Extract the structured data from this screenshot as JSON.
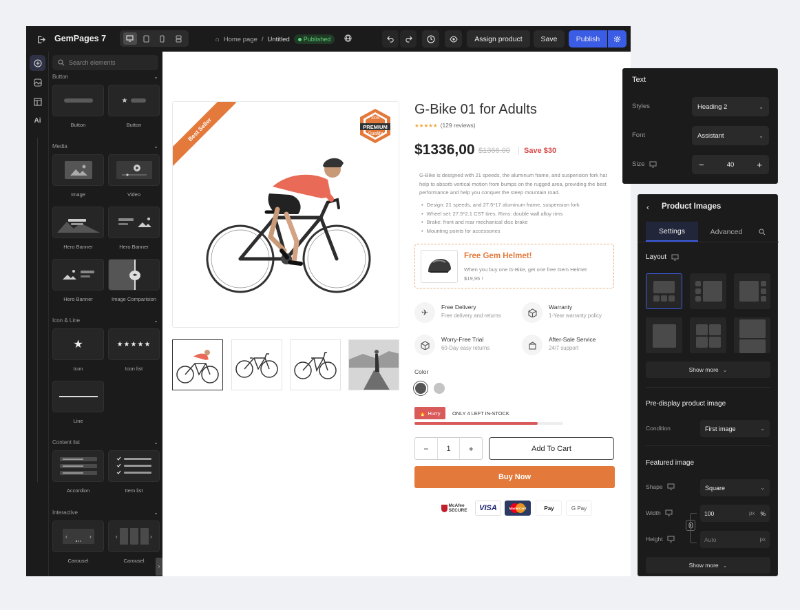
{
  "topbar": {
    "app_name": "GemPages 7",
    "breadcrumb_home": "Home page",
    "breadcrumb_sep": "/",
    "page_name": "Untitled",
    "status": "Published",
    "assign_product": "Assign product",
    "save": "Save",
    "publish": "Publish"
  },
  "elements_panel": {
    "search_placeholder": "Search elements",
    "sections": {
      "button": "Button",
      "media": "Media",
      "icon_line": "Icon & Line",
      "content_list": "Content list",
      "interactive": "Interactive"
    },
    "items": {
      "button1": "Button",
      "button2": "Button",
      "image": "Image",
      "video": "Video",
      "hero1": "Hero Banner",
      "hero2": "Hero Banner",
      "hero3": "Hero Banner",
      "image_comparison": "Image Comparision",
      "icon": "Icon",
      "icon_list": "Icon list",
      "line": "Line",
      "accordion": "Accordion",
      "item_list": "Item list",
      "carousel1": "Carousel",
      "carousel2": "Carousel"
    }
  },
  "product": {
    "ribbon": "Best Seller",
    "badge_top": "100%",
    "badge_main": "PREMIUM",
    "badge_sub": "Quality",
    "title": "G-Bike 01 for Adults",
    "stars": "★★★★★",
    "reviews": "(129 reviews)",
    "price": "$1336,00",
    "old_price": "$1366.00",
    "save": "Save $30",
    "description": "G-Bike is designed with 21 speeds, the aluminum frame, and suspension fork hat help to absorb vertical motion from bumps on the rugged area, providing the best performance and help you conquer the steep mountain road.",
    "bullets": [
      "Design: 21 speeds, and 27.5*17 aluminum frame, suspension fork",
      "Wheel set: 27.5*2.1 CST tires. Rims: double wall alloy rims",
      "Brake: front and rear mechanical disc brake",
      "Mounting points for accessories"
    ],
    "promo_title": "Free Gem Helmet!",
    "promo_text": "When you buy one G-Bike, get one free Gem Helmet $19,95 !",
    "features": [
      {
        "title": "Free Delivery",
        "sub": "Free delivery and returns"
      },
      {
        "title": "Warranty",
        "sub": "1-Year warranty policy"
      },
      {
        "title": "Worry-Free Trial",
        "sub": "60-Day easy returns"
      },
      {
        "title": "After-Sale Service",
        "sub": "24/7 support"
      }
    ],
    "color_label": "Color",
    "colors": [
      "#555555",
      "#c4c4c4"
    ],
    "hurry": "Hurry",
    "stock_text": "ONLY 4 LEFT IN-STOCK",
    "stock_progress": 0.83,
    "quantity": "1",
    "qty_minus": "−",
    "qty_plus": "+",
    "add_to_cart": "Add To Cart",
    "buy_now": "Buy Now",
    "payments": {
      "mcafee": "McAfee SECURE",
      "visa": "VISA",
      "mastercard": "MasterCard",
      "apple": "Pay",
      "google": "G Pay"
    }
  },
  "text_panel": {
    "title": "Text",
    "styles_label": "Styles",
    "styles_value": "Heading 2",
    "font_label": "Font",
    "font_value": "Assistant",
    "size_label": "Size",
    "size_value": "40",
    "minus": "−",
    "plus": "+"
  },
  "images_panel": {
    "title": "Product Images",
    "tab_settings": "Settings",
    "tab_advanced": "Advanced",
    "layout_label": "Layout",
    "show_more": "Show more",
    "predisplay_title": "Pre-display product image",
    "condition_label": "Condition",
    "condition_value": "First image",
    "featured_title": "Featured image",
    "shape_label": "Shape",
    "shape_value": "Square",
    "width_label": "Width",
    "width_value": "100",
    "width_unit_px": "px",
    "width_unit_pct": "%",
    "height_label": "Height",
    "height_placeholder": "Auto",
    "height_unit": "px",
    "show_more_2": "Show more"
  },
  "colors": {
    "accent": "#3b5ce4",
    "orange": "#e3793b",
    "published_green": "#5ed37a",
    "hurry_red": "#d85a5a"
  }
}
